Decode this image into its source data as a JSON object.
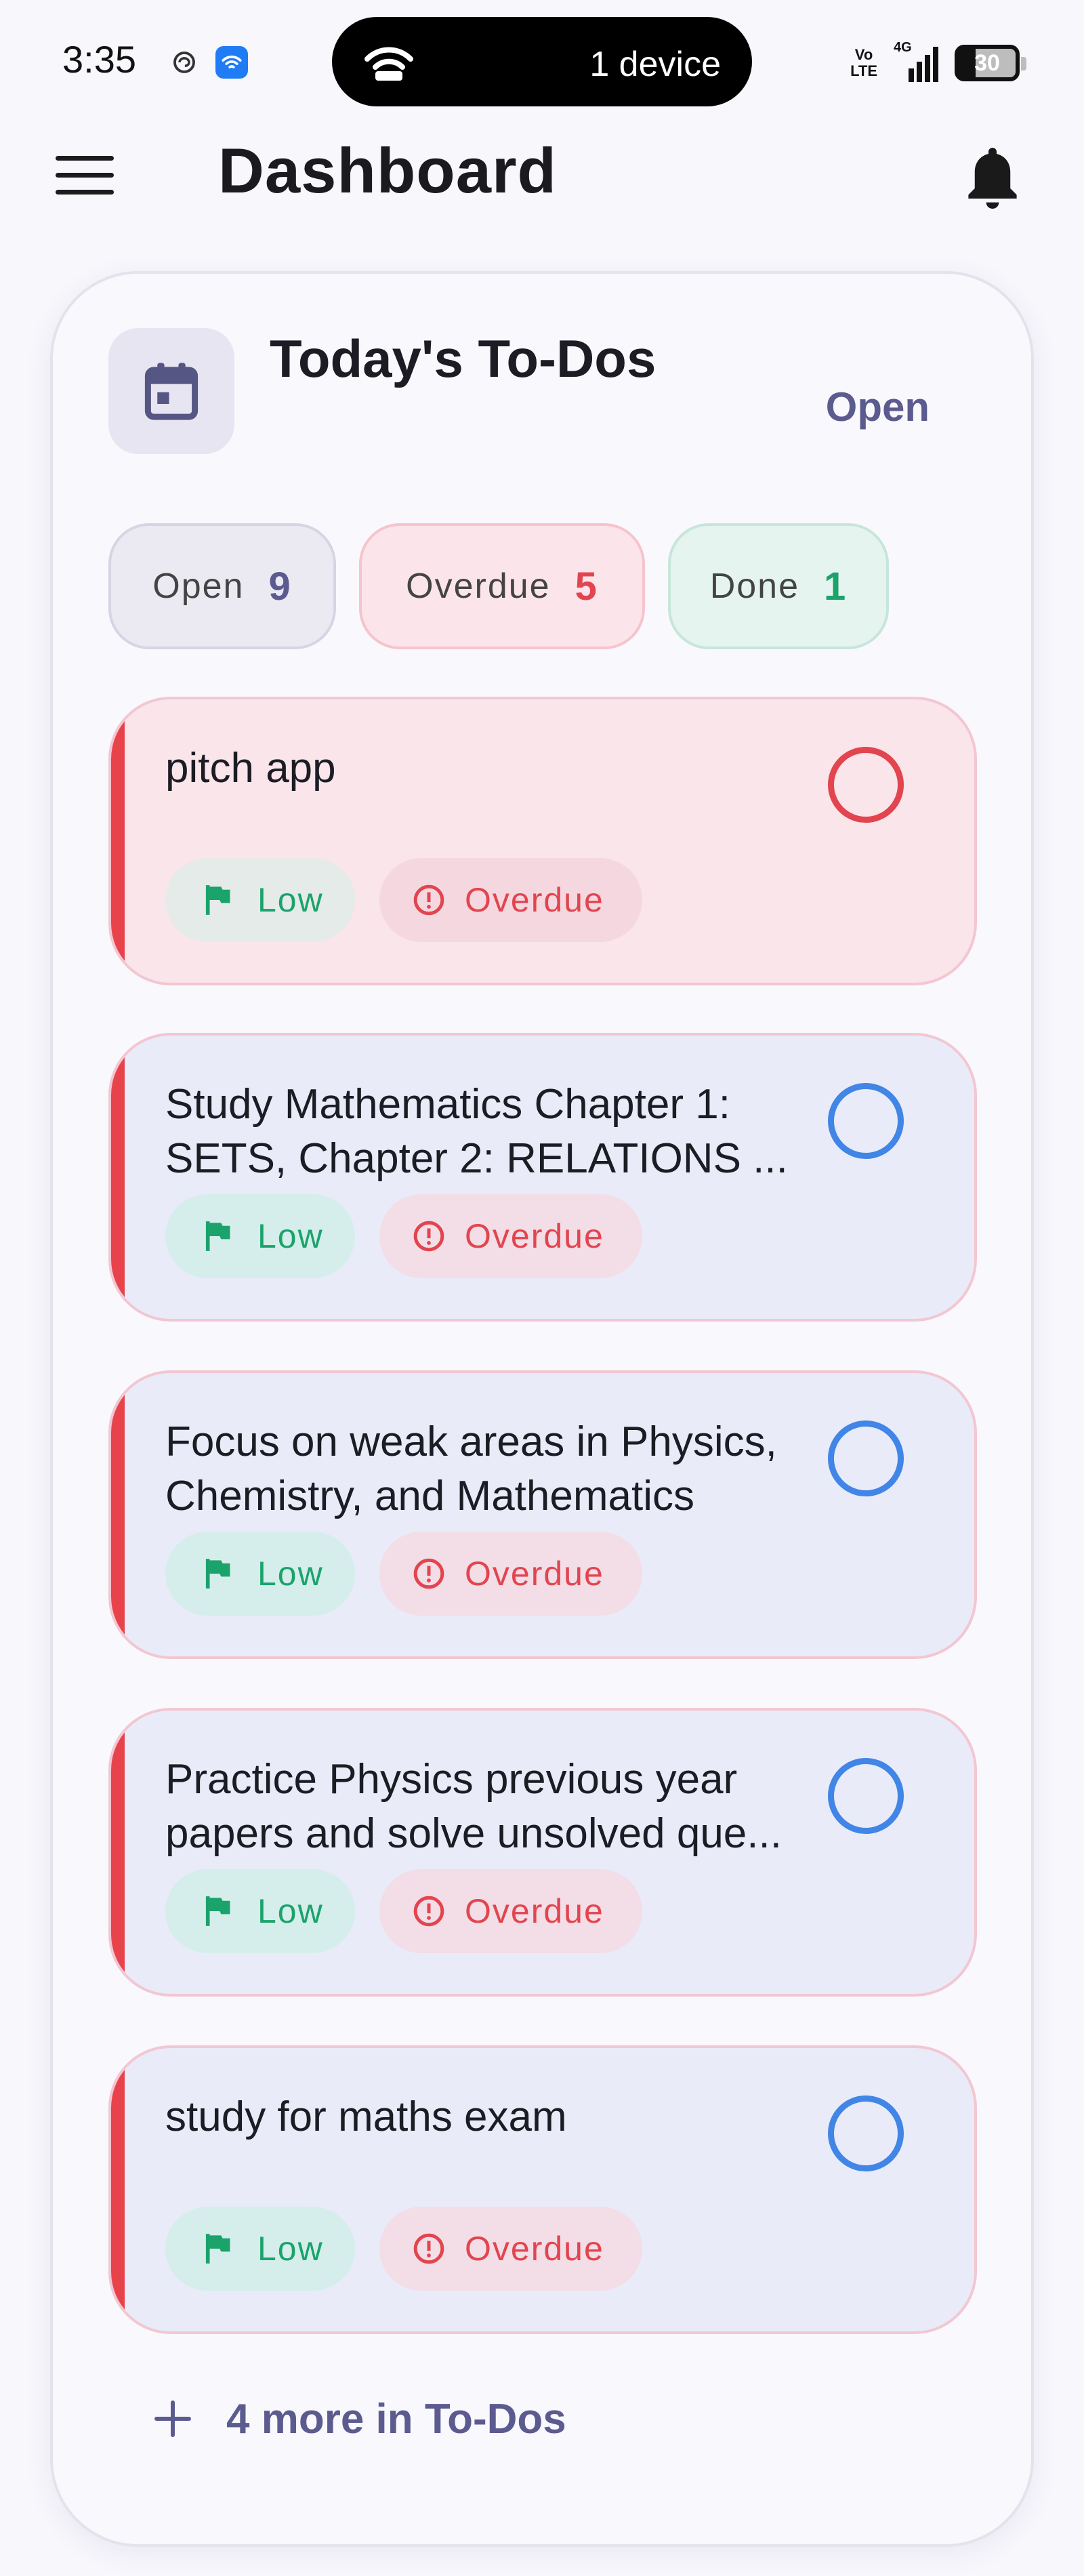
{
  "status_bar": {
    "time": "3:35",
    "connection_text": "1 device",
    "network_label_top": "Vo",
    "network_label_bottom": "LTE",
    "signal_label": "4G",
    "battery_level": "30"
  },
  "app_bar": {
    "title": "Dashboard"
  },
  "card": {
    "title": "Today's To-Dos",
    "open_link": "Open",
    "filters": {
      "open": {
        "label": "Open",
        "count": "9"
      },
      "overdue": {
        "label": "Overdue",
        "count": "5"
      },
      "done": {
        "label": "Done",
        "count": "1"
      }
    },
    "todos": [
      {
        "title_lines": [
          "pitch app",
          ""
        ],
        "priority": "Low",
        "status": "Overdue",
        "highlighted": true
      },
      {
        "title_lines": [
          "Study Mathematics Chapter 1:",
          "SETS, Chapter 2: RELATIONS ..."
        ],
        "priority": "Low",
        "status": "Overdue",
        "highlighted": false
      },
      {
        "title_lines": [
          "Focus on weak areas in Physics,",
          "Chemistry, and Mathematics"
        ],
        "priority": "Low",
        "status": "Overdue",
        "highlighted": false
      },
      {
        "title_lines": [
          "Practice Physics previous year",
          "papers and solve unsolved que..."
        ],
        "priority": "Low",
        "status": "Overdue",
        "highlighted": false
      },
      {
        "title_lines": [
          "study for maths exam",
          ""
        ],
        "priority": "Low",
        "status": "Overdue",
        "highlighted": false
      }
    ],
    "more_link": "4 more in To-Dos"
  },
  "colors": {
    "accent": "#5b5b8f",
    "overdue_red": "#e2454f",
    "done_green": "#1aa36b",
    "check_blue": "#4185e6"
  },
  "icons": {
    "menu": "menu-icon",
    "notifications": "bell-icon",
    "calendar": "calendar-icon",
    "priority": "flag-icon",
    "status": "alert-circle-icon",
    "add": "plus-icon"
  }
}
